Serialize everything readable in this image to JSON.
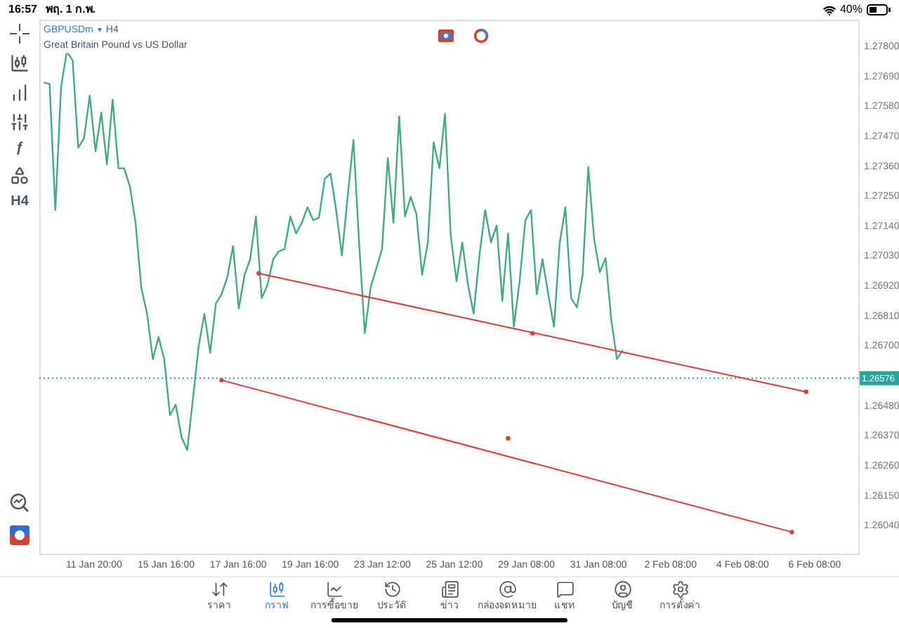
{
  "status_bar": {
    "time": "16:57",
    "date": "พฤ. 1 ก.พ.",
    "battery": "40%"
  },
  "left_toolbar": [
    {
      "kind": "crosshair"
    },
    {
      "kind": "candles"
    },
    {
      "kind": "indicators"
    },
    {
      "kind": "sliders"
    },
    {
      "kind": "text",
      "label": "ƒ"
    },
    {
      "kind": "shapes"
    },
    {
      "kind": "text",
      "label": "H4"
    }
  ],
  "left_toolbar_bottom": [
    {
      "kind": "search-chart"
    },
    {
      "kind": "logo"
    }
  ],
  "chart_header": {
    "symbol": "GBPUSDm",
    "caret": "▾",
    "timeframe": "H4",
    "description": "Great Britain Pound vs US Dollar"
  },
  "chart": {
    "time_labels": [
      "11 Jan 20:00",
      "15 Jan 16:00",
      "17 Jan 16:00",
      "19 Jan 16:00",
      "23 Jan 12:00",
      "25 Jan 12:00",
      "29 Jan 08:00",
      "31 Jan 08:00",
      "2 Feb 08:00",
      "4 Feb 08:00",
      "6 Feb 08:00"
    ],
    "chart_data": {
      "type": "line",
      "ylim": [
        1.25932,
        1.27893
      ],
      "ref_lines": [
        {
          "axis": "y",
          "value": 1.26576,
          "label": "1.26576"
        }
      ],
      "yticks": [
        {
          "value": 1.278,
          "label": "1.27800"
        },
        {
          "value": 1.2769,
          "label": "1.27690"
        },
        {
          "value": 1.2758,
          "label": "1.27580"
        },
        {
          "value": 1.2747,
          "label": "1.27470"
        },
        {
          "value": 1.2736,
          "label": "1.27360"
        },
        {
          "value": 1.2725,
          "label": "1.27250"
        },
        {
          "value": 1.2714,
          "label": "1.27140"
        },
        {
          "value": 1.2703,
          "label": "1.27030"
        },
        {
          "value": 1.2692,
          "label": "1.26920"
        },
        {
          "value": 1.2681,
          "label": "1.26810"
        },
        {
          "value": 1.267,
          "label": "1.26700"
        },
        {
          "value": 1.2648,
          "label": "1.26480"
        },
        {
          "value": 1.2637,
          "label": "1.26370"
        },
        {
          "value": 1.2626,
          "label": "1.26260"
        },
        {
          "value": 1.2615,
          "label": "1.26150"
        },
        {
          "value": 1.2604,
          "label": "1.26040"
        }
      ],
      "series": [
        {
          "color": "#3dae7f",
          "values": [
            1.27662,
            1.27657,
            1.27194,
            1.27647,
            1.27776,
            1.27743,
            1.27423,
            1.27457,
            1.27614,
            1.27409,
            1.27552,
            1.27361,
            1.276,
            1.27347,
            1.27347,
            1.2728,
            1.27147,
            1.26908,
            1.26813,
            1.26646,
            1.26727,
            1.26646,
            1.26441,
            1.26479,
            1.2636,
            1.26312,
            1.26498,
            1.26693,
            1.26813,
            1.2667,
            1.26851,
            1.26884,
            1.26946,
            1.27061,
            1.26832,
            1.26956,
            1.27013,
            1.2717,
            1.2687,
            1.26918,
            1.27013,
            1.27042,
            1.27051,
            1.2717,
            1.27108,
            1.27147,
            1.27204,
            1.27156,
            1.27166,
            1.27309,
            1.27328,
            1.27194,
            1.27027,
            1.27242,
            1.27452,
            1.2707,
            1.26741,
            1.26908,
            1.2698,
            1.27051,
            1.27385,
            1.27147,
            1.27538,
            1.2717,
            1.27242,
            1.2718,
            1.26956,
            1.27075,
            1.27442,
            1.27347,
            1.27547,
            1.27099,
            1.26932,
            1.27075,
            1.26918,
            1.26813,
            1.27027,
            1.27194,
            1.27075,
            1.27137,
            1.2686,
            1.27108,
            1.26765,
            1.26932,
            1.27156,
            1.27194,
            1.26884,
            1.27013,
            1.26884,
            1.26765,
            1.2707,
            1.27204,
            1.2687,
            1.26836,
            1.26956,
            1.27352,
            1.27089,
            1.26965,
            1.27018,
            1.26789,
            1.26646,
            1.26679
          ]
        }
      ]
    }
  },
  "tab_bar": [
    {
      "kind": "quotes",
      "label": "ราคา",
      "selected": false
    },
    {
      "kind": "chart",
      "label": "กราฟ",
      "selected": true
    },
    {
      "kind": "trade",
      "label": "การซื้อขาย",
      "selected": false
    },
    {
      "kind": "history",
      "label": "ประวัติ",
      "selected": false
    },
    {
      "kind": "news",
      "label": "ข่าว",
      "selected": false
    },
    {
      "kind": "mail",
      "label": "กล่องจดหมาย",
      "selected": false
    },
    {
      "kind": "chat",
      "label": "แชท",
      "selected": false
    },
    {
      "kind": "account",
      "label": "บัญชี",
      "selected": false
    },
    {
      "kind": "settings",
      "label": "การตั้งค่า",
      "selected": false
    }
  ]
}
